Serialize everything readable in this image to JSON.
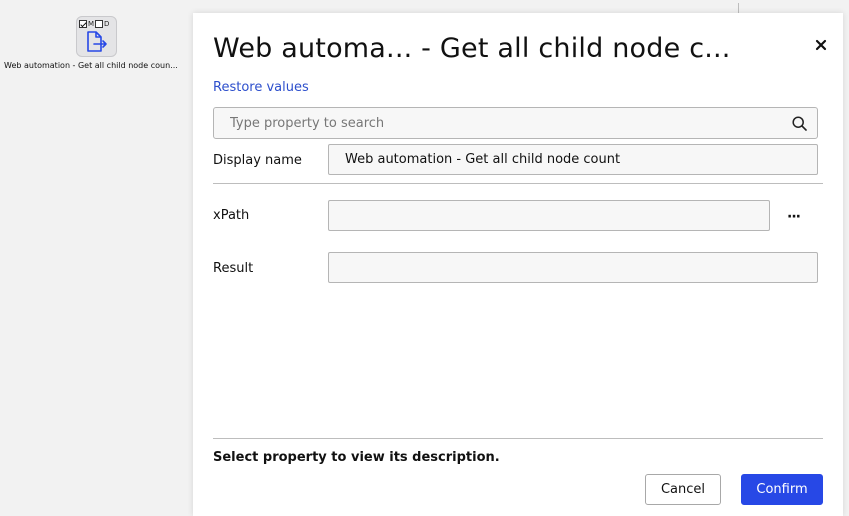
{
  "canvas": {
    "node": {
      "flags": [
        {
          "label": "M",
          "checked": true
        },
        {
          "label": "D",
          "checked": false
        }
      ],
      "icon": "document-arrow-icon",
      "label": "Web automation - Get all child node coun..."
    }
  },
  "dialog": {
    "title": "Web automa... - Get all child node c...",
    "close_icon": "close-icon",
    "restore_label": "Restore values",
    "search": {
      "placeholder": "Type property to search",
      "value": "",
      "icon": "search-icon"
    },
    "display_name": {
      "label": "Display name",
      "value": "Web automation - Get all child node count"
    },
    "xpath": {
      "label": "xPath",
      "value": "",
      "more_label": "···"
    },
    "result": {
      "label": "Result",
      "value": ""
    },
    "description": "Select property to view its description.",
    "cancel_label": "Cancel",
    "confirm_label": "Confirm"
  },
  "colors": {
    "accent": "#2748e6",
    "link": "#2d4fcc"
  }
}
